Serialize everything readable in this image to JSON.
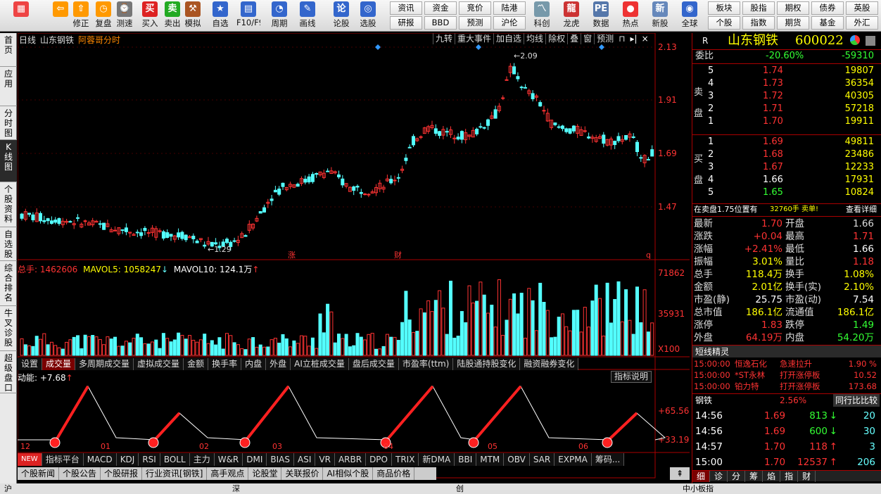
{
  "toolbar": {
    "buttons": [
      {
        "label": "",
        "icon": "home-icon",
        "color": "#e44"
      },
      {
        "label": "",
        "icon": "back-icon",
        "color": "#f90"
      },
      {
        "label": "修正",
        "icon": "up-icon",
        "color": "#f90"
      },
      {
        "label": "复盘",
        "icon": "clock-icon",
        "color": "#f90"
      },
      {
        "label": "测速",
        "icon": "speed-icon",
        "color": "#777"
      },
      {
        "label": "买入",
        "icon": "buy-icon",
        "color": "#d22"
      },
      {
        "label": "卖出",
        "icon": "sell-icon",
        "color": "#2a2"
      },
      {
        "label": "模拟",
        "icon": "hammer-icon",
        "color": "#a52"
      },
      {
        "label": "自选",
        "icon": "star-icon",
        "color": "#36c"
      },
      {
        "label": "F10/F9",
        "icon": "f10-icon",
        "color": "#36c"
      },
      {
        "label": "周期",
        "icon": "period-icon",
        "color": "#36c"
      },
      {
        "label": "画线",
        "icon": "pen-icon",
        "color": "#36c"
      },
      {
        "label": "论股",
        "icon": "discuss-icon",
        "color": "#36c"
      },
      {
        "label": "选股",
        "icon": "select-icon",
        "color": "#36c"
      }
    ],
    "grid": [
      "资讯",
      "资金",
      "竞价",
      "陆港",
      "研报",
      "BBD",
      "预测",
      "沪伦"
    ],
    "icon_buttons": [
      {
        "label": "科创",
        "icon": "chart-icon"
      },
      {
        "label": "龙虎",
        "icon": "dragon-icon"
      },
      {
        "label": "数据",
        "icon": "pe-icon"
      },
      {
        "label": "热点",
        "icon": "hot-icon"
      },
      {
        "label": "新股",
        "icon": "new-icon"
      },
      {
        "label": "全球",
        "icon": "globe-icon"
      }
    ],
    "grid2": [
      "板块",
      "股指",
      "期权",
      "债券",
      "英股",
      "个股",
      "指数",
      "期货",
      "基金",
      "外汇"
    ]
  },
  "sidebar": [
    "首页",
    "应用",
    "分时图",
    "K线图",
    "个股资料",
    "自选股",
    "综合排名",
    "牛叉诊股",
    "超级盘口"
  ],
  "chart_header": {
    "a": "日线",
    "b": "山东钢铁",
    "c": "阿蓉哥分时"
  },
  "chart_tools": [
    "九转",
    "重大事件",
    "加自选",
    "均线",
    "除权",
    "叠",
    "窗",
    "预测"
  ],
  "price_axis": [
    "2.13",
    "1.91",
    "1.69",
    "1.47"
  ],
  "annot": {
    "high": "2.09",
    "low": "1.29",
    "z": "涨",
    "c": "财",
    "q": "q"
  },
  "vol_header": {
    "label": "总手: ",
    "v": "1462606",
    "ma5l": "MAVOL5: ",
    "ma5": "1058247",
    "ma10l": "MAVOL10: ",
    "ma10": "124.1万"
  },
  "vol_axis": [
    "71862",
    "35931",
    "X100"
  ],
  "vol_tabs": [
    "设置",
    "成交量",
    "多周期成交量",
    "虚拟成交量",
    "金额",
    "换手率",
    "内盘",
    "外盘",
    "AI立桩成交量",
    "盘后成交量",
    "市盈率(ttm)",
    "陆股通持股变化",
    "融资融券变化"
  ],
  "mom_header": {
    "label": "动能: ",
    "v": "+7.68"
  },
  "mom_help": "指标说明",
  "mom_axis": [
    "+65.56",
    "+33.19"
  ],
  "x_axis": [
    "12",
    "01",
    "02",
    "03",
    "04",
    "05",
    "06"
  ],
  "ind_tabs": [
    "NEW",
    "指标平台",
    "MACD",
    "KDJ",
    "RSI",
    "BOLL",
    "主力",
    "W&R",
    "DMI",
    "BIAS",
    "ASI",
    "VR",
    "ARBR",
    "DPO",
    "TRIX",
    "新DMA",
    "BBI",
    "MTM",
    "OBV",
    "SAR",
    "EXPMA",
    "筹码..."
  ],
  "bottom_tabs": [
    "个股新闻",
    "个股公告",
    "个股研报",
    "行业资讯[钢铁]",
    "高手观点",
    "论股堂",
    "关联报价",
    "AI相似个股",
    "商品价格"
  ],
  "quote": {
    "r": "R",
    "name": "山东钢铁",
    "code": "600022",
    "weibi": {
      "label": "委比",
      "pct": "-20.60%",
      "diff": "-59310"
    },
    "sell": [
      [
        "5",
        "1.74",
        "19807"
      ],
      [
        "4",
        "1.73",
        "36354"
      ],
      [
        "3",
        "1.72",
        "40305"
      ],
      [
        "2",
        "1.71",
        "57218"
      ],
      [
        "1",
        "1.70",
        "19911"
      ]
    ],
    "buy": [
      [
        "1",
        "1.69",
        "49811"
      ],
      [
        "2",
        "1.68",
        "23486"
      ],
      [
        "3",
        "1.67",
        "12233"
      ],
      [
        "4",
        "1.66",
        "17931"
      ],
      [
        "5",
        "1.65",
        "10824"
      ]
    ],
    "sell_label": "卖盘",
    "buy_label": "买盘",
    "notice": "在卖盘1.75位置有",
    "notice_num": "32760手 卖单!",
    "notice_link": "查看详细",
    "stats": [
      [
        "最新",
        "1.70",
        "开盘",
        "1.66"
      ],
      [
        "涨跌",
        "+0.04",
        "最高",
        "1.71"
      ],
      [
        "涨幅",
        "+2.41%",
        "最低",
        "1.66"
      ],
      [
        "振幅",
        "3.01%",
        "量比",
        "1.18"
      ],
      [
        "总手",
        "118.4万",
        "换手",
        "1.08%"
      ],
      [
        "金额",
        "2.01亿",
        "换手(实)",
        "2.10%"
      ],
      [
        "市盈(静)",
        "25.75",
        "市盈(动)",
        "7.54"
      ],
      [
        "总市值",
        "186.1亿",
        "流通值",
        "186.1亿"
      ],
      [
        "涨停",
        "1.83",
        "跌停",
        "1.49"
      ],
      [
        "外盘",
        "64.19万",
        "内盘",
        "54.20万"
      ]
    ],
    "sprite_title": "短线精灵",
    "sprites": [
      [
        "15:00:00",
        "恒逸石化",
        "急速拉升",
        "1.90 %"
      ],
      [
        "15:00:00",
        "*ST永林",
        "打开涨停板",
        "10.52"
      ],
      [
        "15:00:00",
        "铂力特",
        "打开涨停板",
        "173.68"
      ]
    ],
    "industry": {
      "name": "钢铁",
      "pct": "2.56%",
      "btn": "同行比比较"
    },
    "ticks": [
      [
        "14:56",
        "1.69",
        "813",
        "20"
      ],
      [
        "14:56",
        "1.69",
        "600",
        "30"
      ],
      [
        "14:57",
        "1.70",
        "118",
        "3"
      ],
      [
        "15:00",
        "1.70",
        "12537",
        "206"
      ]
    ],
    "tabs": [
      "细",
      "诊",
      "分",
      "筹",
      "焰",
      "指",
      "财"
    ]
  },
  "status": {
    "a": "沪",
    "b": "深",
    "c": "创",
    "d": "中小板指"
  }
}
